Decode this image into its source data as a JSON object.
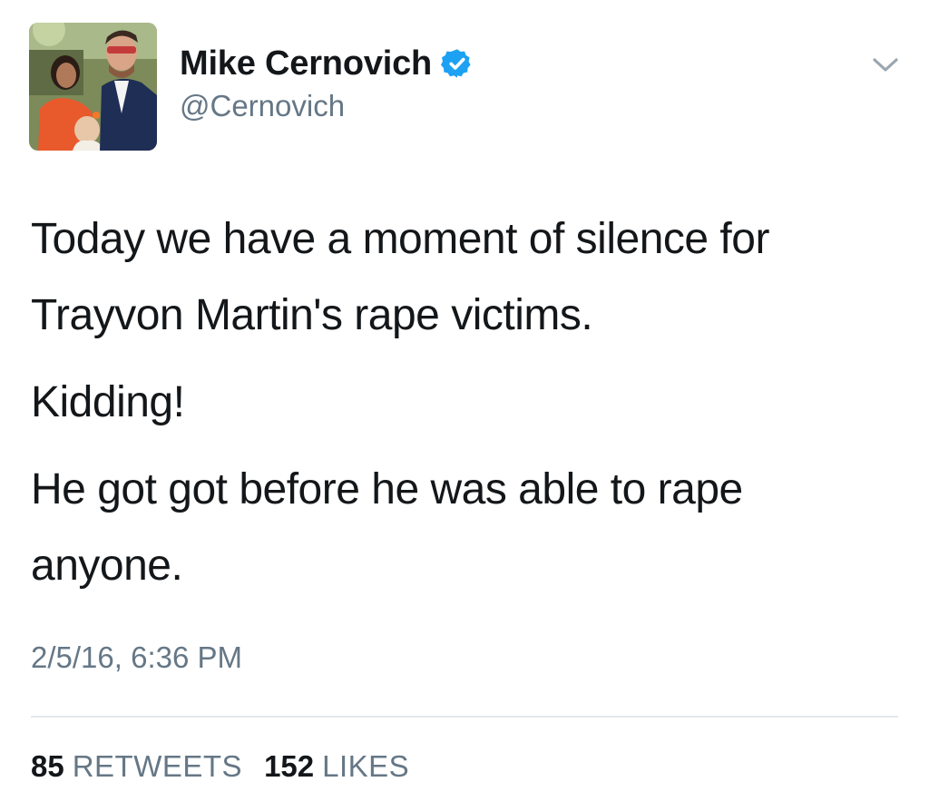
{
  "author": {
    "display_name": "Mike Cernovich",
    "handle": "@Cernovich",
    "verified": true,
    "avatar_icon": "profile-photo"
  },
  "tweet": {
    "paragraphs": [
      "Today we have a moment of silence for Trayvon Martin's rape victims.",
      "Kidding!",
      "He got got before he was able to rape anyone."
    ],
    "timestamp": "2/5/16, 6:36 PM"
  },
  "stats": {
    "retweets_count": "85",
    "retweets_label": "RETWEETS",
    "likes_count": "152",
    "likes_label": "LIKES"
  },
  "icons": {
    "verified": "verified-badge-icon",
    "menu": "chevron-down-icon"
  },
  "colors": {
    "text": "#14171a",
    "secondary": "#657786",
    "verified_blue": "#1da1f2",
    "divider": "#e1e8ed"
  }
}
